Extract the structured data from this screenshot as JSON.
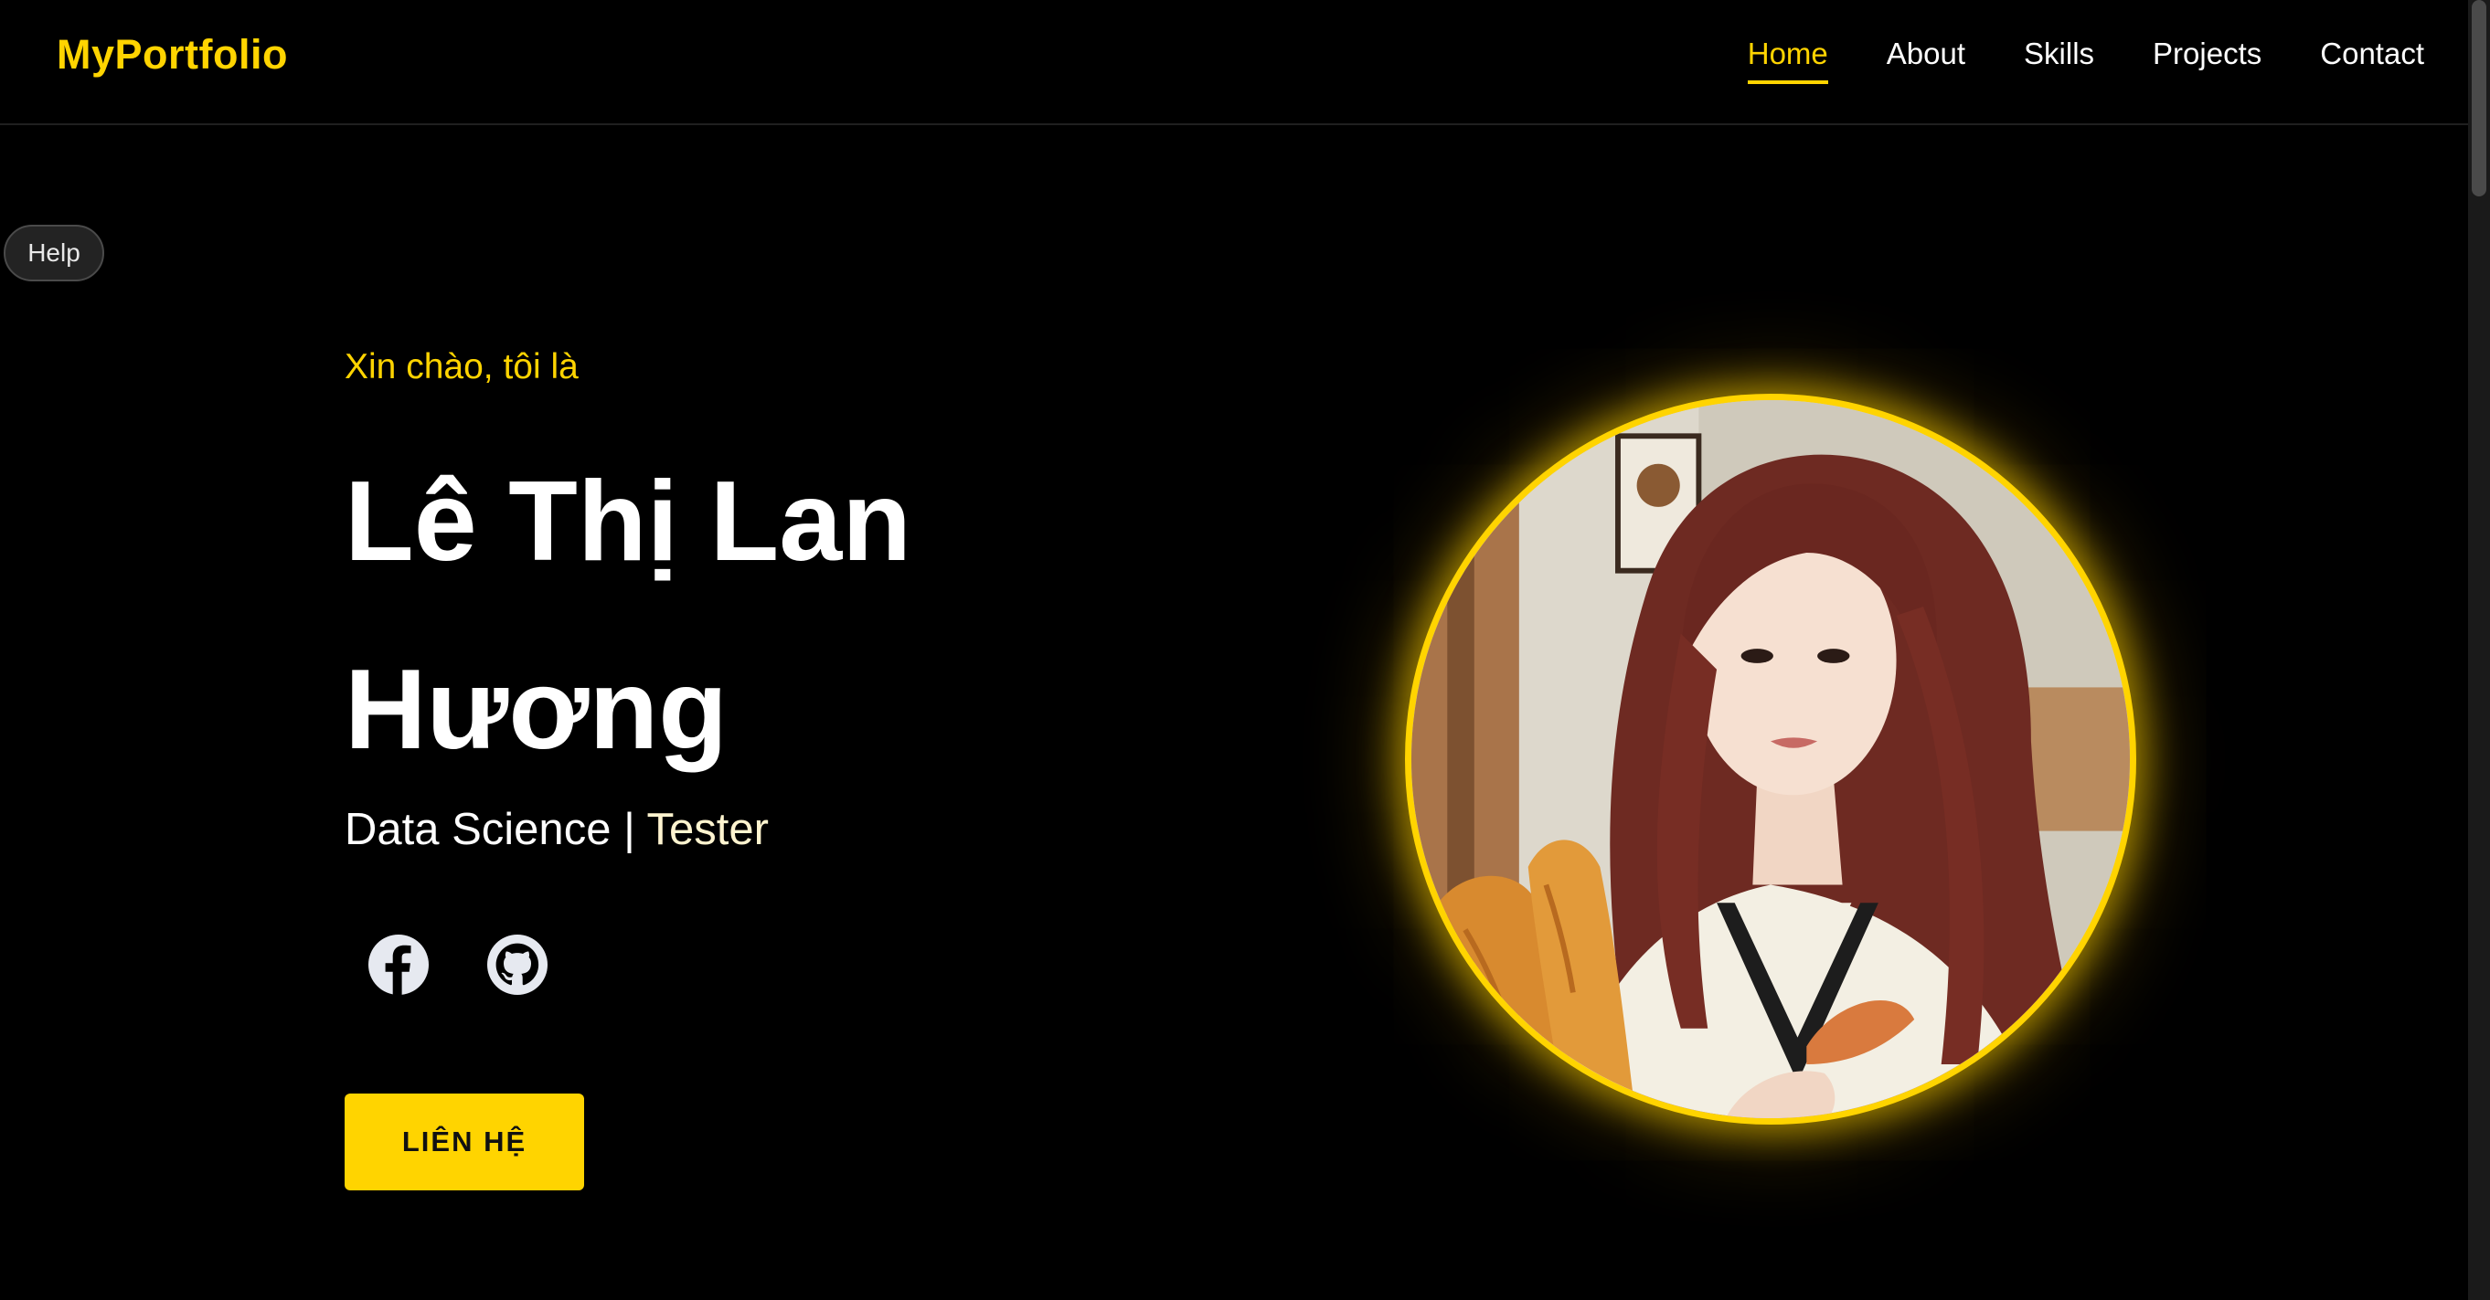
{
  "brand": {
    "logo": "MyPortfolio",
    "accent_color": "#ffd400"
  },
  "nav": {
    "items": [
      {
        "label": "Home",
        "active": true
      },
      {
        "label": "About",
        "active": false
      },
      {
        "label": "Skills",
        "active": false
      },
      {
        "label": "Projects",
        "active": false
      },
      {
        "label": "Contact",
        "active": false
      }
    ]
  },
  "help": {
    "label": "Help"
  },
  "hero": {
    "greeting": "Xin chào, tôi là",
    "name_line1": "Lê Thị Lan",
    "name_line2": "Hương",
    "role1": "Data Science",
    "separator": "|",
    "role2": "Tester",
    "social": [
      {
        "icon": "facebook-icon"
      },
      {
        "icon": "github-icon"
      }
    ],
    "cta_label": "LIÊN HỆ"
  },
  "portrait": {
    "icon": "profile-photo"
  }
}
